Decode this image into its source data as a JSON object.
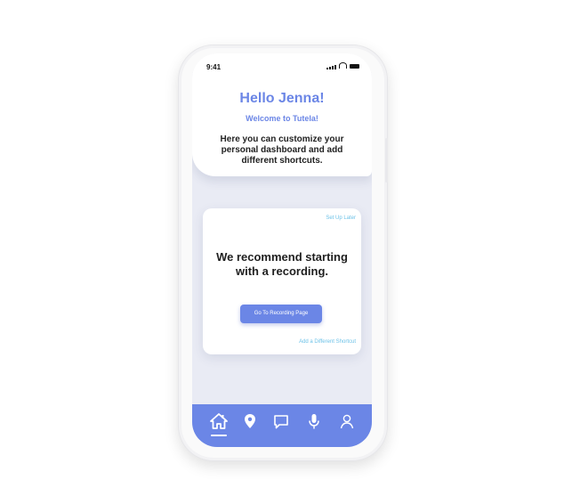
{
  "status": {
    "time": "9:41"
  },
  "header": {
    "greeting": "Hello Jenna!",
    "welcome": "Welcome to Tutela!",
    "description": "Here you can customize your personal dashboard and add different shortcuts."
  },
  "card": {
    "setup_later": "Set Up Later",
    "recommendation": "We recommend starting with a recording.",
    "button_label": "Go To Recording Page",
    "add_shortcut": "Add a Different Shortcut"
  },
  "tabbar": {
    "icons": [
      "home-icon",
      "location-pin-icon",
      "chat-icon",
      "microphone-icon",
      "profile-icon"
    ],
    "active": "home"
  },
  "colors": {
    "accent": "#6b86e6",
    "link": "#6dc2e8",
    "screen_bg": "#e9ebf4"
  }
}
